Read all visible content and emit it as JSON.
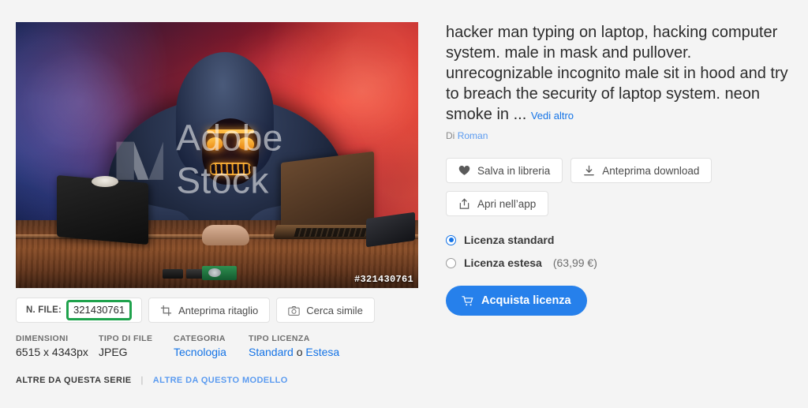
{
  "preview": {
    "watermark_text": "Adobe Stock",
    "watermark_logo": "adobe-stock-logo",
    "image_id_overlay": "#321430761",
    "alt": "hacker man typing on laptop with neon LED mask in hood, red and blue smoke"
  },
  "file_bar": {
    "file_label": "N. FILE:",
    "file_number": "321430761",
    "crop_button": "Anteprima ritaglio",
    "crop_icon": "crop-icon",
    "similar_button": "Cerca simile",
    "similar_icon": "camera-icon"
  },
  "meta": [
    {
      "head": "DIMENSIONI",
      "value": "6515 x 4343px",
      "link": false
    },
    {
      "head": "TIPO DI FILE",
      "value": "JPEG",
      "link": false
    },
    {
      "head": "CATEGORIA",
      "value": "Tecnologia",
      "link": true
    },
    {
      "head": "TIPO LICENZA",
      "value": "Standard",
      "value2": "Estesa",
      "separator": " o ",
      "link": true
    }
  ],
  "bottom_links": {
    "series": "ALTRE DA QUESTA SERIE",
    "divider": "|",
    "model": "ALTRE DA QUESTO MODELLO"
  },
  "detail": {
    "title": "hacker man typing on laptop, hacking computer system. male in mask and pullover. unrecognizable incognito male sit in hood and try to breach the security of laptop system. neon smoke in ...",
    "see_more": "Vedi altro",
    "by_prefix": "Di",
    "author": "Roman"
  },
  "actions": {
    "save": {
      "label": "Salva in libreria",
      "icon": "heart-icon"
    },
    "preview_download": {
      "label": "Anteprima download",
      "icon": "download-icon"
    },
    "open_in_app": {
      "label": "Apri nell’app",
      "icon": "share-icon"
    }
  },
  "license": {
    "standard": {
      "label": "Licenza standard",
      "selected": true
    },
    "extended": {
      "label": "Licenza estesa",
      "price": "(63,99 €)",
      "selected": false
    },
    "buy_button": "Acquista licenza",
    "buy_icon": "cart-icon"
  },
  "colors": {
    "page_bg": "#f4f4f4",
    "accent_blue": "#1473e6",
    "buy_blue": "#2680eb",
    "highlight_green": "#1fa24c",
    "text_dark": "#2c2c2c"
  }
}
